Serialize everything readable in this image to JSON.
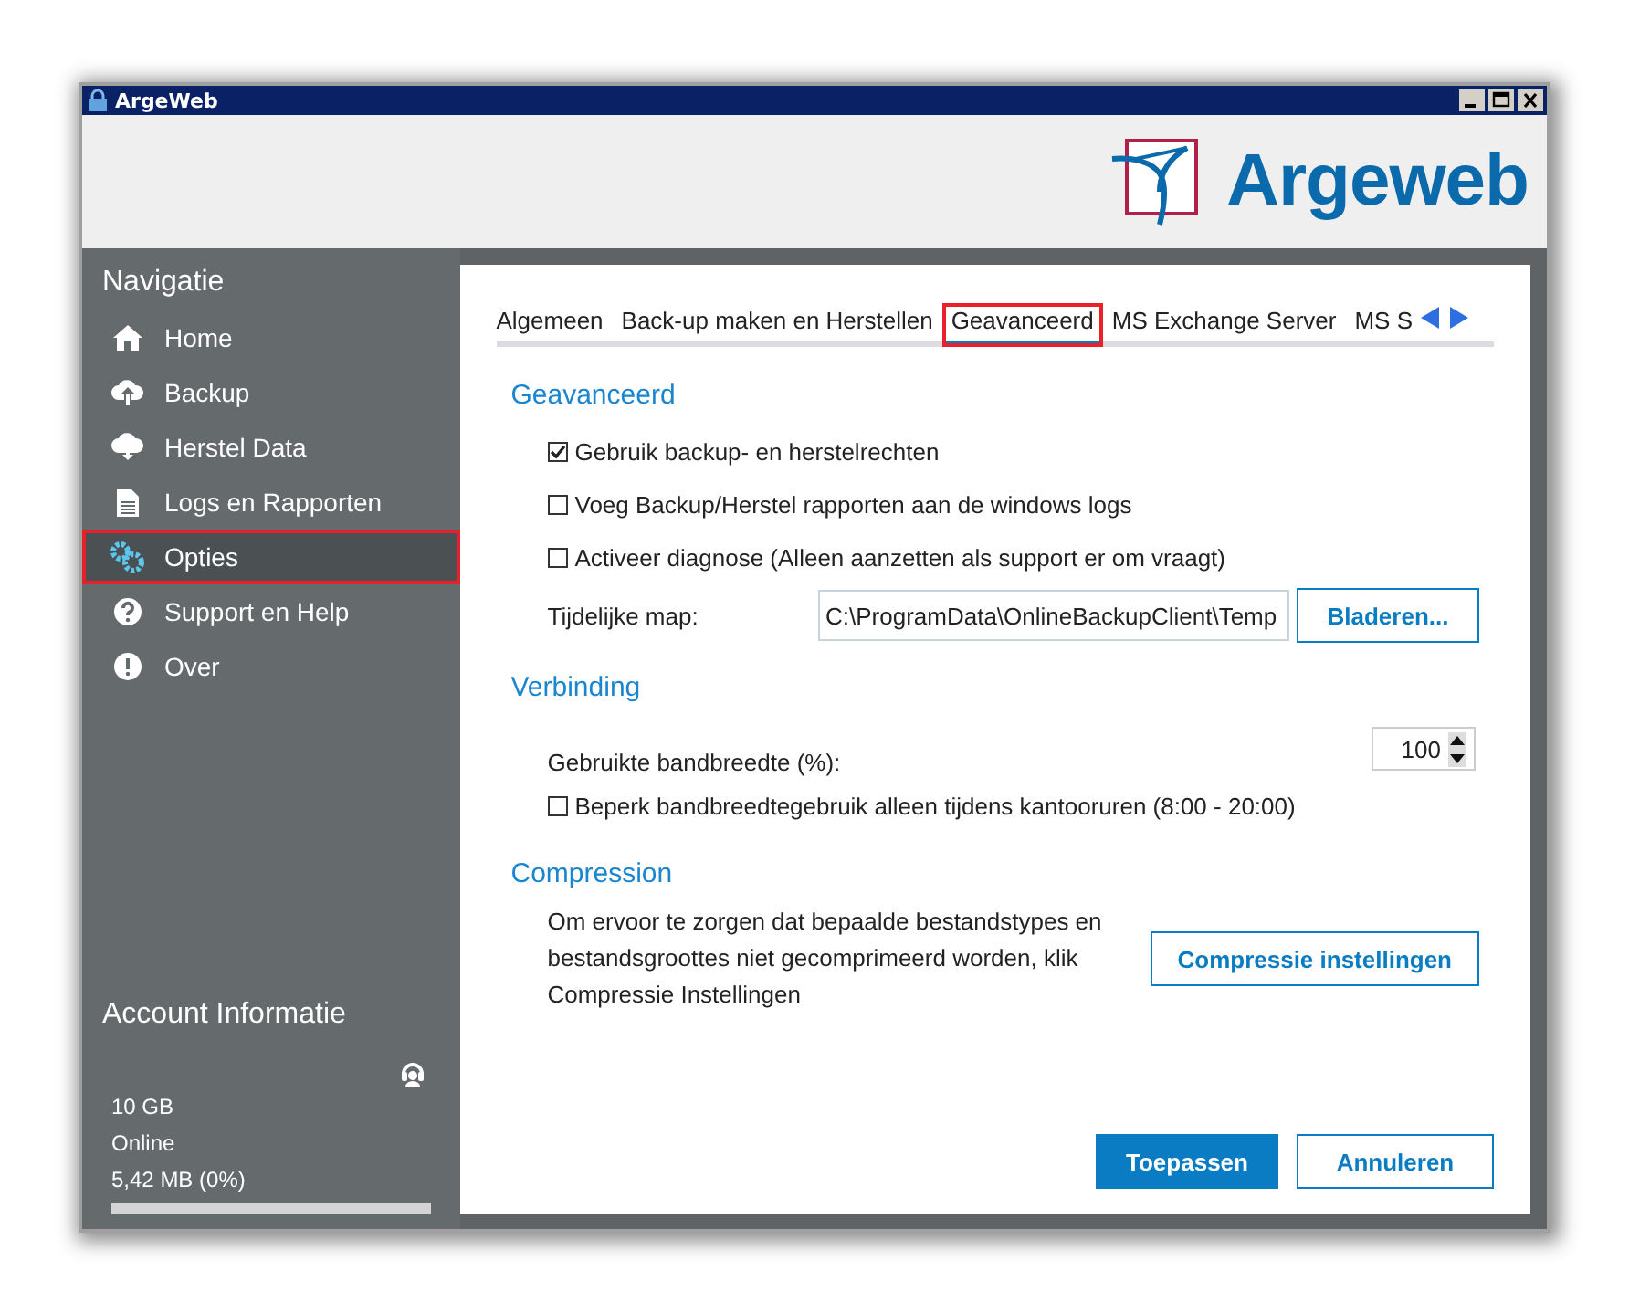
{
  "window": {
    "title": "ArgeWeb"
  },
  "logo": {
    "text": "Argeweb"
  },
  "sidebar": {
    "heading": "Navigatie",
    "items": [
      {
        "label": "Home",
        "selected": false,
        "highlighted": false
      },
      {
        "label": "Backup",
        "selected": false,
        "highlighted": false
      },
      {
        "label": "Herstel Data",
        "selected": false,
        "highlighted": false
      },
      {
        "label": "Logs en Rapporten",
        "selected": false,
        "highlighted": false
      },
      {
        "label": "Opties",
        "selected": true,
        "highlighted": true
      },
      {
        "label": "Support en Help",
        "selected": false,
        "highlighted": false
      },
      {
        "label": "Over",
        "selected": false,
        "highlighted": false
      }
    ],
    "account": {
      "heading": "Account Informatie",
      "quota": "10 GB",
      "status": "Online",
      "usage": "5,42 MB (0%)",
      "level": 0
    }
  },
  "tabs": [
    {
      "label": "Algemeen",
      "selected": false,
      "highlighted": false
    },
    {
      "label": "Back-up maken en Herstellen",
      "selected": false,
      "highlighted": false
    },
    {
      "label": "Geavanceerd",
      "selected": true,
      "highlighted": true
    },
    {
      "label": "MS Exchange Server",
      "selected": false,
      "highlighted": false
    },
    {
      "label": "MS S",
      "selected": false,
      "highlighted": false
    }
  ],
  "sections": [
    {
      "title": "Geavanceerd",
      "rows": [
        {
          "kind": "checkbox",
          "label": "Gebruik backup- en herstelrechten",
          "checked": true
        },
        {
          "kind": "checkbox",
          "label": "Voeg Backup/Herstel rapporten aan de windows logs",
          "checked": false
        },
        {
          "kind": "checkbox",
          "label": "Activeer diagnose (Alleen aanzetten als support er om vraagt)",
          "checked": false
        },
        {
          "kind": "folder",
          "label": "Tijdelijke map:",
          "value": "C:\\ProgramData\\OnlineBackupClient\\Temp",
          "button": "Bladeren..."
        }
      ]
    },
    {
      "title": "Verbinding",
      "rows": [
        {
          "kind": "spinner",
          "label": "Gebruikte bandbreedte (%):",
          "value": "100"
        },
        {
          "kind": "checkbox",
          "label": "Beperk bandbreedtegebruik alleen tijdens kantooruren (8:00 - 20:00)",
          "checked": false
        }
      ]
    },
    {
      "title": "Compression",
      "rows": [
        {
          "kind": "info",
          "text": "Om ervoor te zorgen dat bepaalde bestandstypes en bestandsgroottes niet gecomprimeerd worden, klik Compressie Instellingen",
          "button": "Compressie instellingen"
        }
      ]
    }
  ],
  "buttons": [
    {
      "label": "Toepassen",
      "primary": true
    },
    {
      "label": "Annuleren",
      "primary": false
    }
  ]
}
